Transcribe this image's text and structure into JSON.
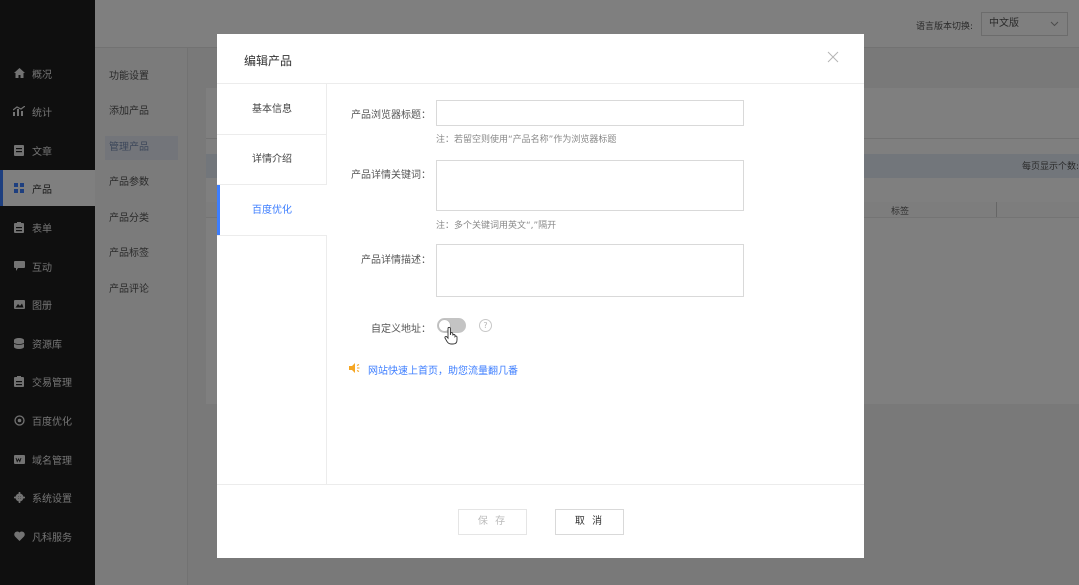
{
  "topbar": {
    "lang_label": "语言版本切换:",
    "lang_value": "中文版"
  },
  "left_nav": {
    "items": [
      {
        "label": "概况",
        "icon": "home-icon"
      },
      {
        "label": "统计",
        "icon": "stats-icon"
      },
      {
        "label": "文章",
        "icon": "article-icon"
      },
      {
        "label": "产品",
        "icon": "product-icon",
        "active": true
      },
      {
        "label": "表单",
        "icon": "form-icon"
      },
      {
        "label": "互动",
        "icon": "chat-icon"
      },
      {
        "label": "图册",
        "icon": "gallery-icon"
      },
      {
        "label": "资源库",
        "icon": "database-icon"
      },
      {
        "label": "交易管理",
        "icon": "trade-icon"
      },
      {
        "label": "百度优化",
        "icon": "seo-icon"
      },
      {
        "label": "域名管理",
        "icon": "domain-icon"
      },
      {
        "label": "系统设置",
        "icon": "gear-icon"
      },
      {
        "label": "凡科服务",
        "icon": "heart-icon"
      }
    ]
  },
  "sub_nav": {
    "items": [
      {
        "label": "功能设置"
      },
      {
        "label": "添加产品"
      },
      {
        "label": "管理产品",
        "active": true
      },
      {
        "label": "产品参数"
      },
      {
        "label": "产品分类"
      },
      {
        "label": "产品标签"
      },
      {
        "label": "产品评论"
      }
    ]
  },
  "background_table": {
    "per_page_label": "每页显示个数:",
    "tag_column": "标签"
  },
  "modal": {
    "title": "编辑产品",
    "tabs": [
      {
        "label": "基本信息"
      },
      {
        "label": "详情介绍"
      },
      {
        "label": "百度优化",
        "active": true
      }
    ],
    "form": {
      "browser_title_label": "产品浏览器标题：",
      "browser_title_value": "",
      "browser_title_note": "注：若留空则使用“产品名称”作为浏览器标题",
      "keywords_label": "产品详情关键词：",
      "keywords_value": "",
      "keywords_note": "注：多个关键词用英文“,”隔开",
      "description_label": "产品详情描述：",
      "description_value": "",
      "custom_url_label": "自定义地址：",
      "custom_url_enabled": false,
      "help_symbol": "?"
    },
    "promo_text": "网站快速上首页，助您流量翻几番",
    "buttons": {
      "save": "保 存",
      "cancel": "取 消"
    }
  },
  "colors": {
    "accent": "#3d7eff",
    "sidebar": "#1f1f1f",
    "promo_icon": "#f5a623"
  }
}
